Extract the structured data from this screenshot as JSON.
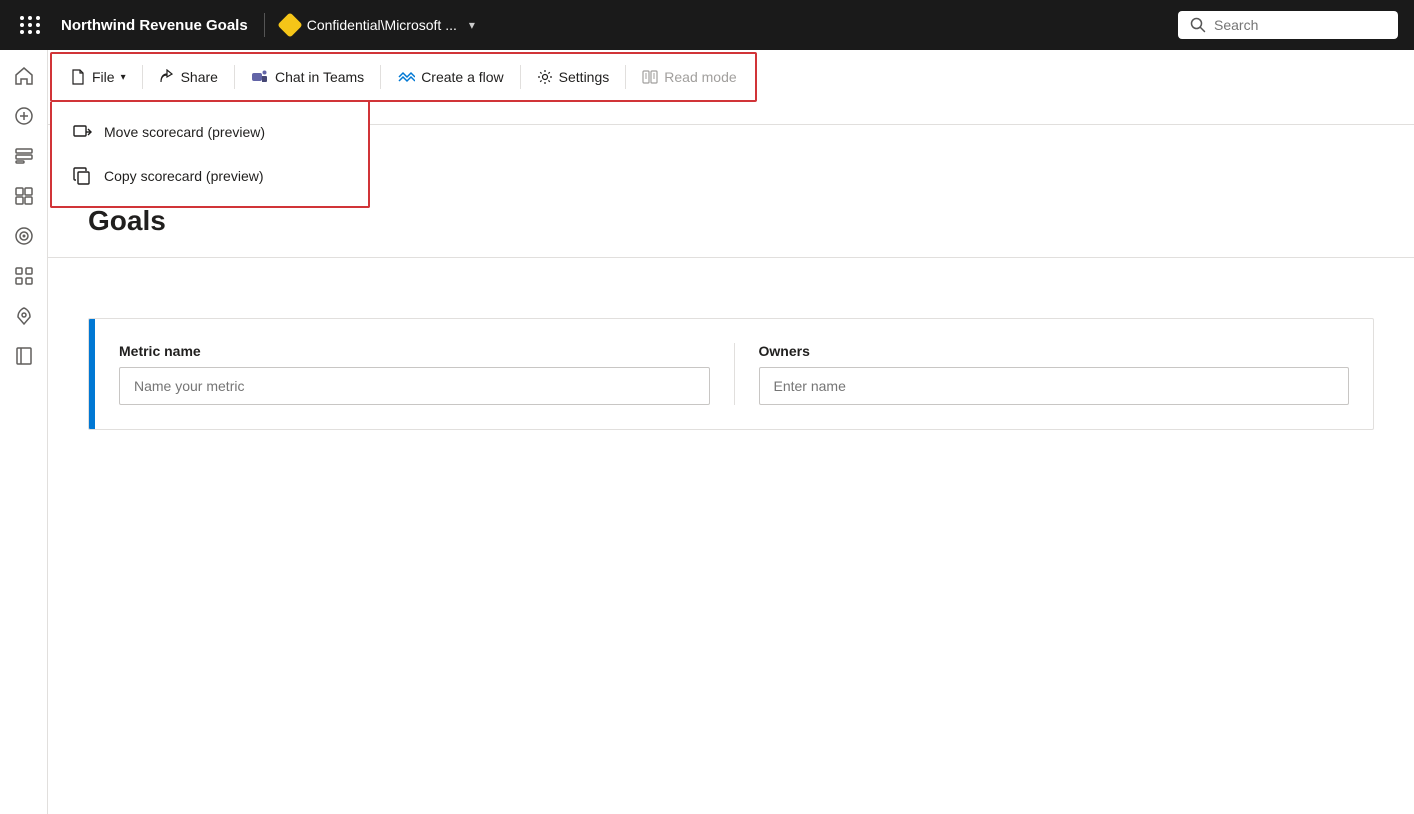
{
  "topbar": {
    "dots_label": "App launcher",
    "title": "Northwind Revenue Goals",
    "confidential_label": "Confidential\\Microsoft ...",
    "search_placeholder": "Search"
  },
  "sidebar": {
    "items": [
      {
        "name": "home",
        "icon": "⌂",
        "label": "Home"
      },
      {
        "name": "create",
        "icon": "+",
        "label": "Create"
      },
      {
        "name": "browse",
        "icon": "⊞",
        "label": "Browse"
      },
      {
        "name": "hub",
        "icon": "⊡",
        "label": "Hub"
      },
      {
        "name": "goals",
        "icon": "🏆",
        "label": "Goals"
      },
      {
        "name": "apps",
        "icon": "⊞",
        "label": "Apps"
      },
      {
        "name": "launch",
        "icon": "🚀",
        "label": "Launch"
      },
      {
        "name": "book",
        "icon": "📖",
        "label": "Book"
      }
    ]
  },
  "toolbar": {
    "file_label": "File",
    "share_label": "Share",
    "chat_label": "Chat in Teams",
    "create_flow_label": "Create a flow",
    "settings_label": "Settings",
    "read_mode_label": "Read mode"
  },
  "dropdown": {
    "items": [
      {
        "label": "Move scorecard (preview)",
        "icon": "move"
      },
      {
        "label": "Copy scorecard (preview)",
        "icon": "copy"
      }
    ]
  },
  "page": {
    "title": "Goals"
  },
  "metric": {
    "name_label": "Metric name",
    "name_placeholder": "Name your metric",
    "owners_label": "Owners",
    "owners_placeholder": "Enter name"
  }
}
